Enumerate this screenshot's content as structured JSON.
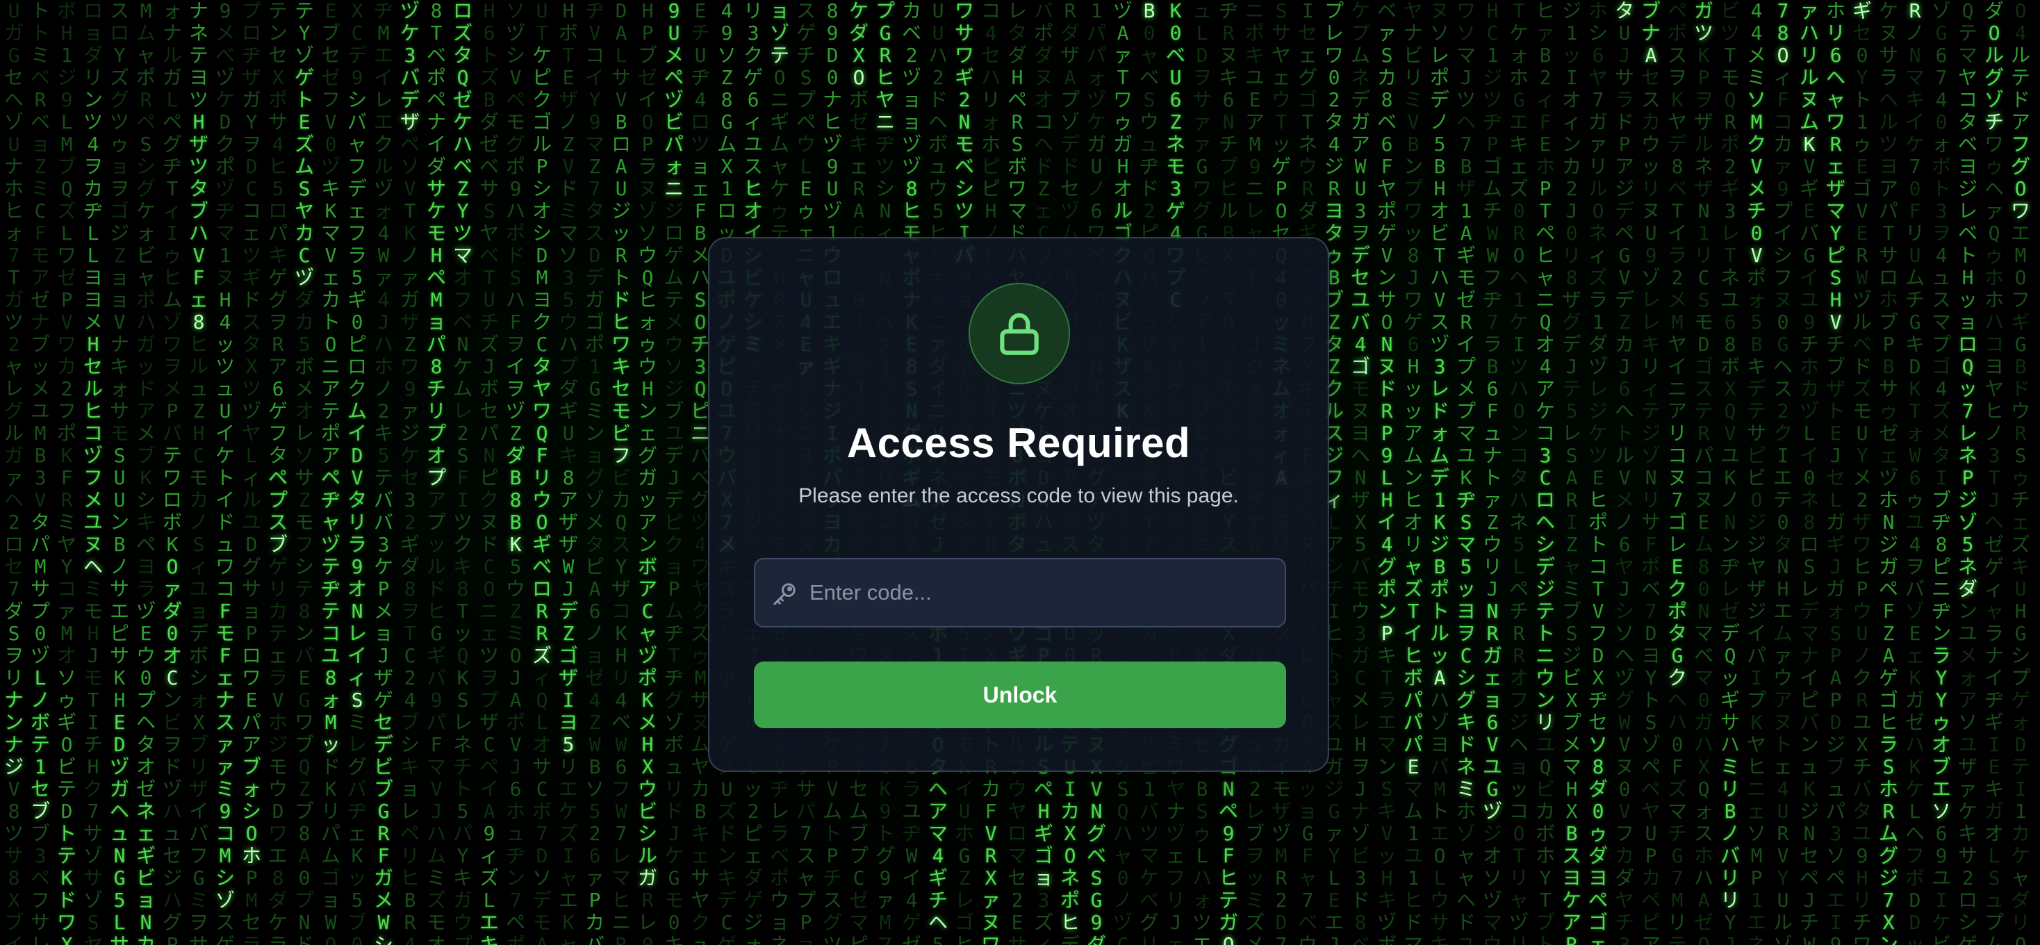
{
  "background": {
    "name": "matrix-rain",
    "colors": {
      "base": "#000000",
      "head": "#b8ffb8",
      "bright": "#4fdc4f",
      "mid": "#2f9f2f",
      "dim": "#184d18"
    }
  },
  "modal": {
    "icon": "lock-icon",
    "title": "Access Required",
    "subtitle": "Please enter the access code to view this page.",
    "input": {
      "icon": "key-icon",
      "placeholder": "Enter code...",
      "value": ""
    },
    "button": {
      "label": "Unlock"
    },
    "colors": {
      "accent": "#3ba44a",
      "icon_green": "#6ee07e",
      "panel": "#10161f",
      "field": "#1d2538",
      "field_border": "#3f4c66"
    }
  }
}
